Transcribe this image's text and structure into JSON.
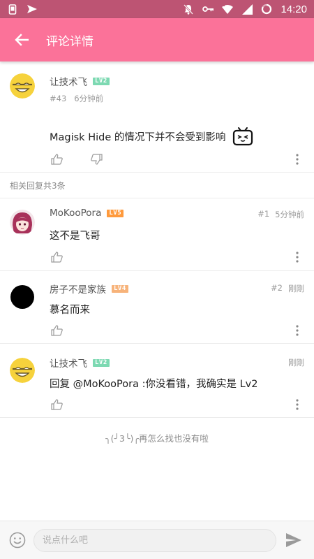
{
  "status_bar": {
    "time": "14:20",
    "left_icons": [
      "phone-icon",
      "send-icon"
    ],
    "right_icons": [
      "bell-off-icon",
      "key-icon",
      "wifi-icon",
      "cellular-icon",
      "battery-icon"
    ]
  },
  "app_bar": {
    "title": "评论详情",
    "background": "#fb7299"
  },
  "main_comment": {
    "username": "让技术飞",
    "level": "LV2",
    "floor": "#43",
    "time": "6分钟前",
    "text": "Magisk Hide 的情况下并不会受到影响",
    "emoji": "bilibili-tv-icon"
  },
  "replies_label": "相关回复共3条",
  "replies": [
    {
      "username": "MoKooPora",
      "level": "LV5",
      "floor": "#1",
      "time": "5分钟前",
      "text": "这不是飞哥"
    },
    {
      "username": "房子不是家族",
      "level": "LV4",
      "floor": "#2",
      "time": "刚刚",
      "text": "慕名而来"
    },
    {
      "username": "让技术飞",
      "level": "LV2",
      "floor": "",
      "time": "刚刚",
      "text": "回复 @MoKooPora :你没看错，我确实是 Lv2"
    }
  ],
  "footer_note": "╮(╯3╰)╭再怎么找也没有啦",
  "input": {
    "placeholder": "说点什么吧",
    "value": ""
  },
  "colors": {
    "status_bar": "#bd5473",
    "accent": "#fb7299",
    "lv2": "#7dd9b2",
    "lv4": "#f7b37a",
    "lv5": "#ff9a3c"
  }
}
